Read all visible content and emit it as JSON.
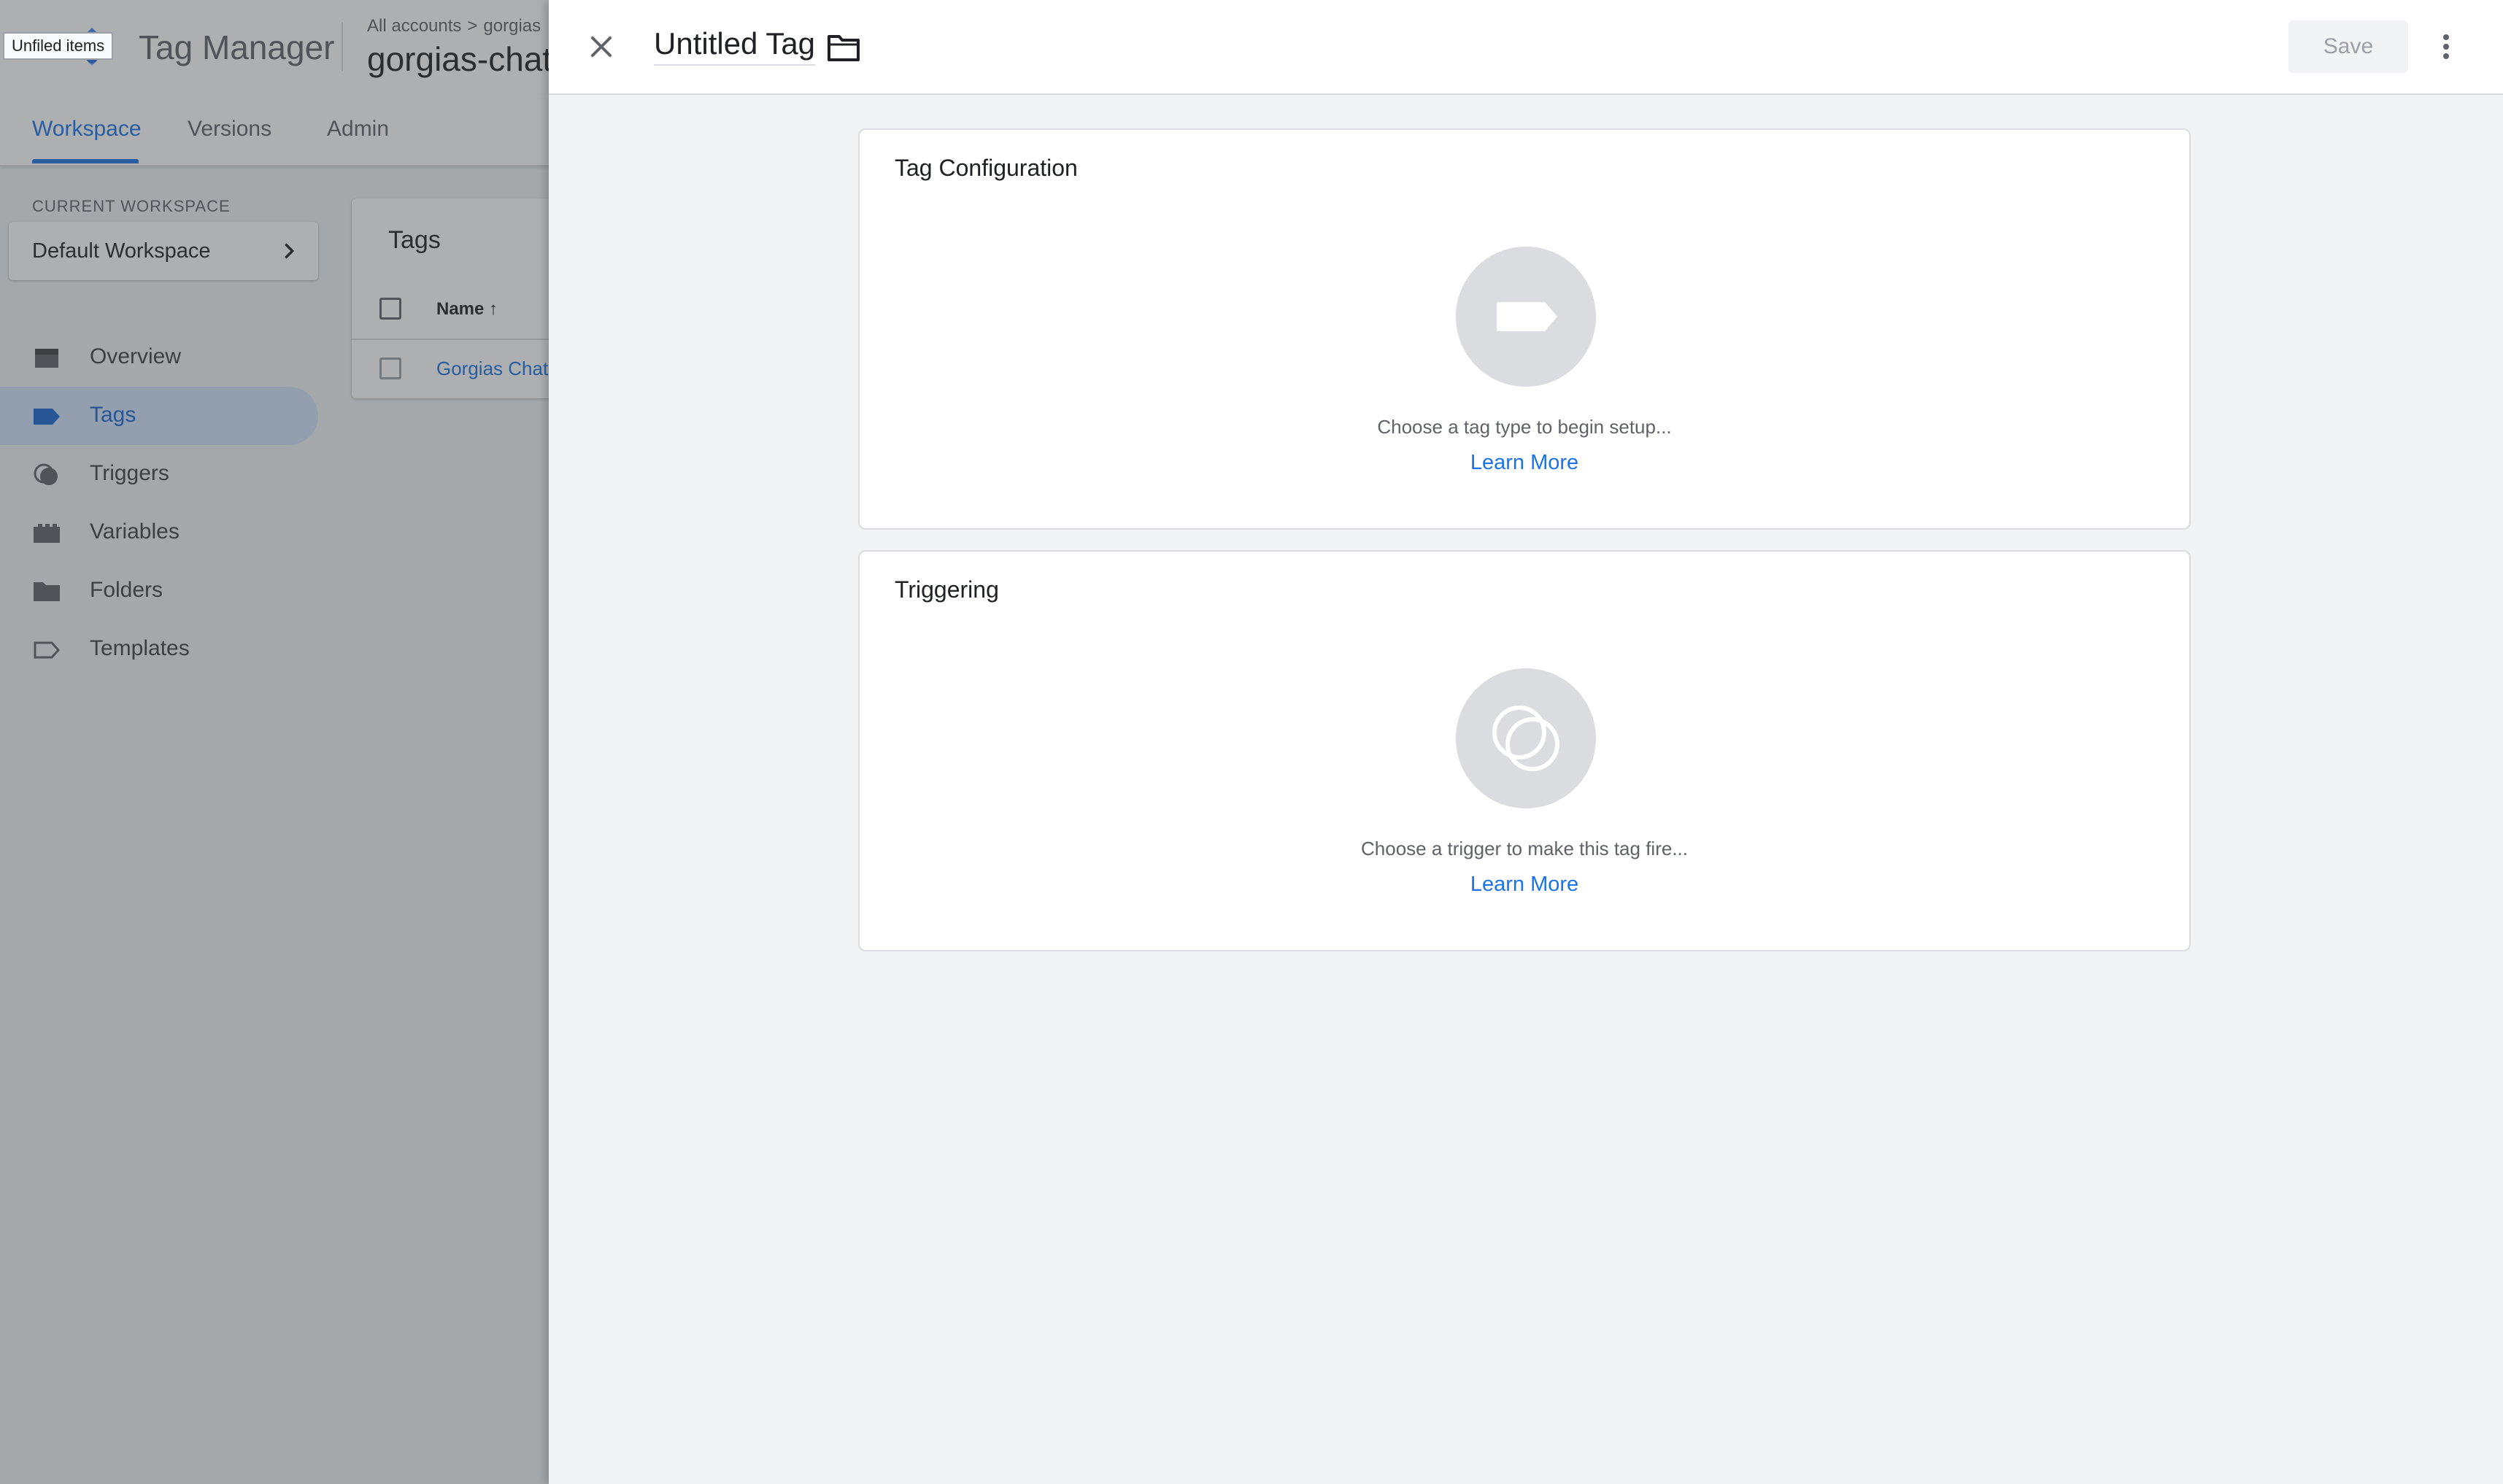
{
  "app": {
    "product_name": "Tag Manager",
    "breadcrumb": {
      "all_accounts": "All accounts",
      "separator": ">",
      "account": "gorgias"
    },
    "container_name": "gorgias-chat",
    "tooltip": "Unfiled items"
  },
  "tabs": [
    {
      "label": "Workspace",
      "active": true
    },
    {
      "label": "Versions",
      "active": false
    },
    {
      "label": "Admin",
      "active": false
    }
  ],
  "workspace": {
    "caption": "CURRENT WORKSPACE",
    "name": "Default Workspace"
  },
  "sidebar": {
    "items": [
      {
        "label": "Overview",
        "icon": "overview-icon",
        "active": false
      },
      {
        "label": "Tags",
        "icon": "tag-icon",
        "active": true
      },
      {
        "label": "Triggers",
        "icon": "trigger-icon",
        "active": false
      },
      {
        "label": "Variables",
        "icon": "variables-icon",
        "active": false
      },
      {
        "label": "Folders",
        "icon": "folder-icon",
        "active": false
      },
      {
        "label": "Templates",
        "icon": "template-icon",
        "active": false
      }
    ]
  },
  "tags_list": {
    "title": "Tags",
    "column_name": "Name",
    "sort": "ascending",
    "rows": [
      {
        "name": "Gorgias Chat"
      }
    ]
  },
  "panel": {
    "tag_name": "Untitled Tag",
    "save_label": "Save",
    "tag_configuration": {
      "title": "Tag Configuration",
      "hint": "Choose a tag type to begin setup...",
      "learn_more": "Learn More"
    },
    "triggering": {
      "title": "Triggering",
      "hint": "Choose a trigger to make this tag fire...",
      "learn_more": "Learn More"
    }
  },
  "colors": {
    "accent": "#1a73e8",
    "active_nav_bg": "#d2e3fc",
    "placeholder_circle": "#dadce0",
    "panel_bg": "#f1f3f4"
  }
}
